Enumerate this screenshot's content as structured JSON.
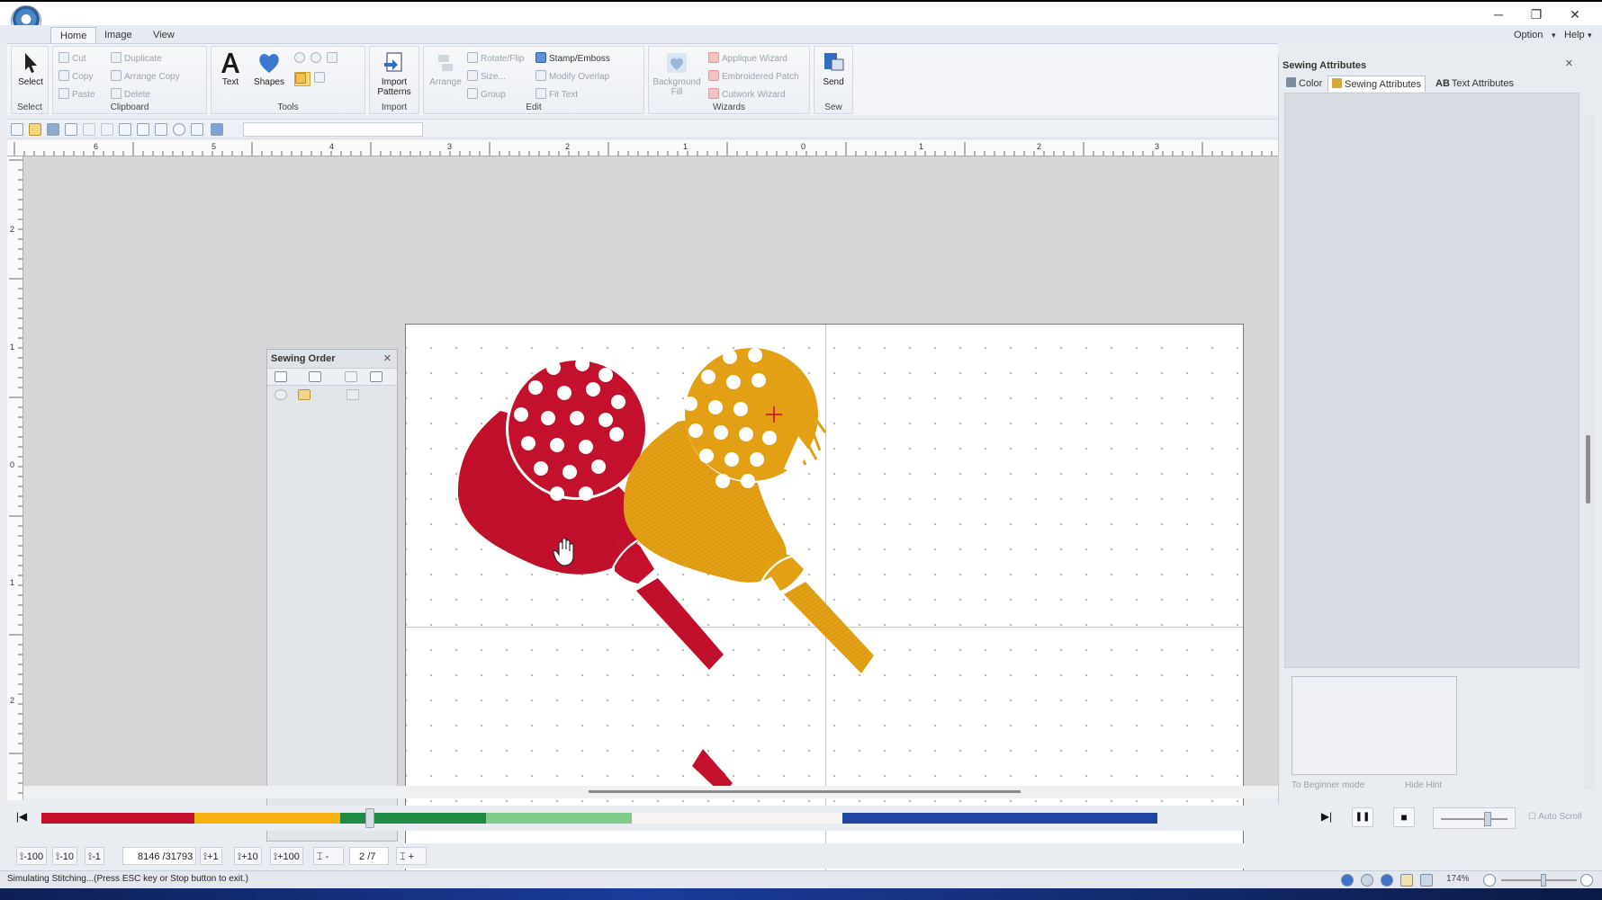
{
  "window": {
    "min_glyph": "─",
    "restore_glyph": "❐",
    "close_glyph": "✕",
    "menu_option": "Option",
    "menu_help": "Help",
    "menu_arrow": "▾"
  },
  "ribbon_tabs": [
    "Home",
    "Image",
    "View"
  ],
  "ribbon": {
    "select": {
      "label": "Select",
      "group": "Select"
    },
    "clipboard": {
      "cut": "Cut",
      "copy": "Copy",
      "paste": "Paste",
      "duplicate": "Duplicate",
      "arrange_copy": "Arrange Copy",
      "delete": "Delete",
      "group": "Clipboard"
    },
    "tools": {
      "text": "Text",
      "shapes": "Shapes",
      "group": "Tools"
    },
    "import": {
      "button": "Import Patterns",
      "group": "Import"
    },
    "edit": {
      "arrange": "Arrange",
      "rotate_flip": "Rotate/Flip",
      "size": "Size...",
      "group_btn": "Group",
      "stamp_emboss": "Stamp/Emboss",
      "modify_overlap": "Modify Overlap",
      "fit_text": "Fit Text",
      "group": "Edit"
    },
    "wizards": {
      "background_fill": "Background Fill",
      "applique": "Applique Wizard",
      "patch": "Embroidered Patch",
      "cutwork": "Cutwork Wizard",
      "group": "Wizards"
    },
    "sew": {
      "send": "Send",
      "group": "Sew"
    }
  },
  "sewing_order": {
    "title": "Sewing Order",
    "close_glyph": "✕"
  },
  "right_panel": {
    "title": "Sewing Attributes",
    "close_glyph": "✕",
    "tabs": [
      "Color",
      "Sewing Attributes",
      "Text Attributes"
    ],
    "text_tab_prefix": "AB",
    "beginner_btn": "To Beginner mode",
    "hide_hint_btn": "Hide Hint"
  },
  "playback": {
    "first_glyph": "|◀",
    "last_glyph": "▶|",
    "pause_glyph": "❚❚",
    "stop_glyph": "■",
    "auto_scroll": "Auto Scroll",
    "progress_fraction": 0.259
  },
  "thread_colors": [
    {
      "name": "red",
      "hex": "#c3102c"
    },
    {
      "name": "gold",
      "hex": "#f5b011"
    },
    {
      "name": "green",
      "hex": "#1e8a45"
    },
    {
      "name": "light-green",
      "hex": "#7fcd8a"
    },
    {
      "name": "white",
      "hex": "#f6f3f0"
    },
    {
      "name": "blue",
      "hex": "#2145a3"
    }
  ],
  "steps": {
    "m100": "-100",
    "m10": "-10",
    "m1": "-1",
    "current": "8146",
    "total": "/31793",
    "p1": "+1",
    "p10": "+10",
    "p100": "+100",
    "color_index": "2",
    "color_total": "/7"
  },
  "status": {
    "message": "Simulating Stitching...(Press ESC key or Stop button to exit.)",
    "zoom": "174%"
  },
  "ruler": {
    "h_labels": [
      "6",
      "5",
      "4",
      "3",
      "2",
      "1",
      "0",
      "1",
      "2",
      "3"
    ],
    "v_labels": [
      "2",
      "1",
      "0",
      "1",
      "2"
    ]
  },
  "design": {
    "paddle_red": "#c3102c",
    "paddle_gold": "#e3a014",
    "stitch_white": "#ffffff"
  }
}
